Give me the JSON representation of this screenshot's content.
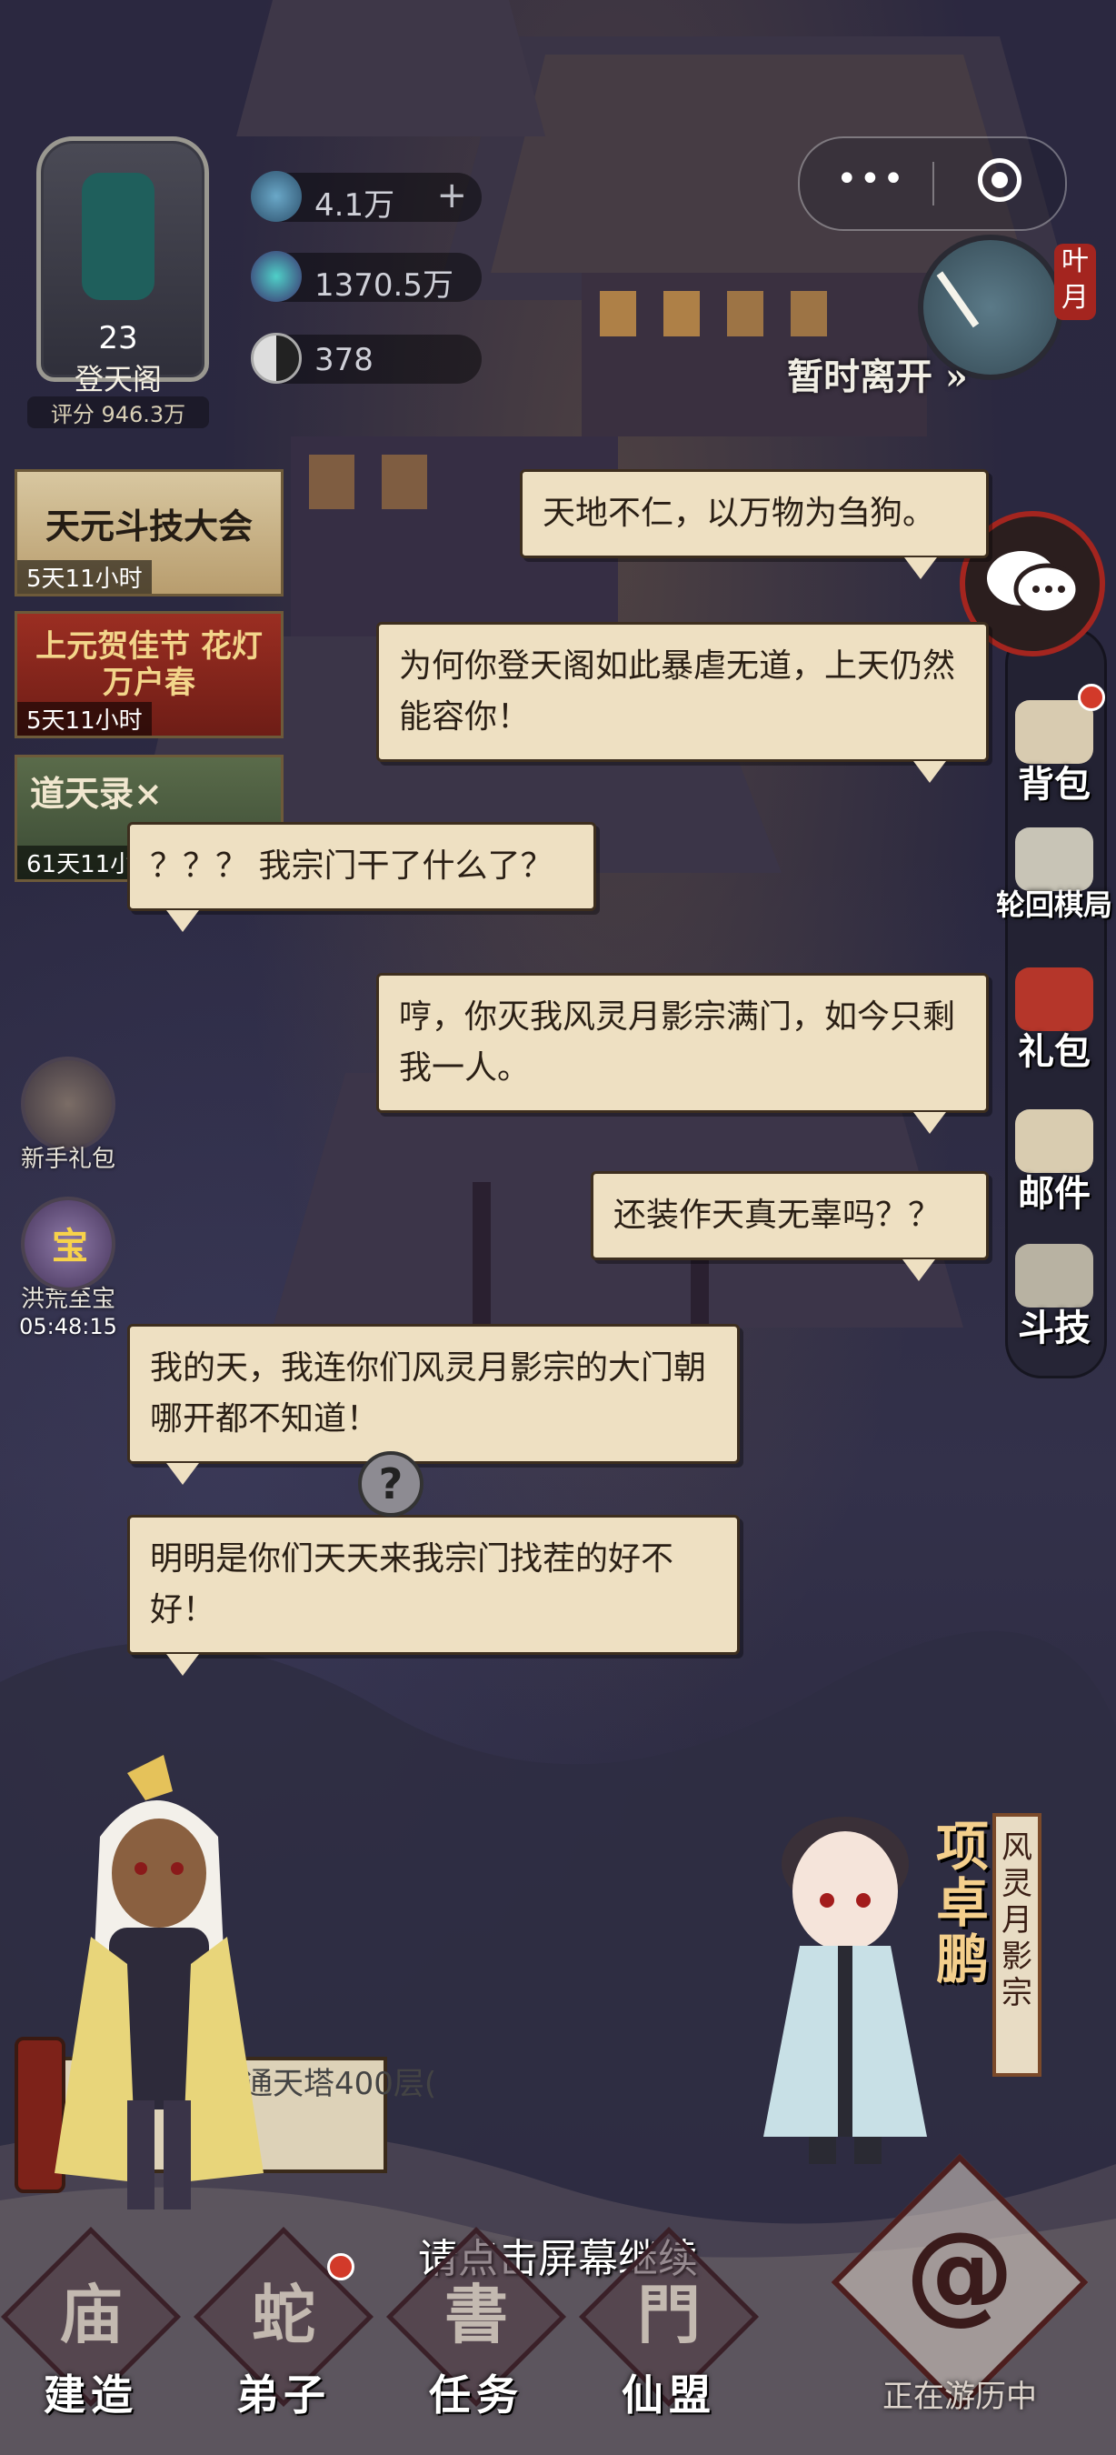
{
  "top": {
    "sect_level": "23",
    "sect_name": "登天阁",
    "sect_score": "评分 946.3万",
    "resources": [
      {
        "icon": "spirit-stone-icon",
        "value": "4.1万",
        "plus": "+"
      },
      {
        "icon": "crystal-icon",
        "value": "1370.5万",
        "plus": ""
      },
      {
        "icon": "yin-yang-icon",
        "value": "378",
        "plus": ""
      }
    ],
    "capsule_menu": "•••",
    "season_tag": "叶月",
    "leave_label": "暂时离开 »"
  },
  "events": [
    {
      "title": "天元斗技大会",
      "timer": "5天11小时"
    },
    {
      "title": "上元贺佳节 花灯万户春",
      "timer": "5天11小时"
    },
    {
      "title": "道天录×",
      "timer": "61天11小"
    }
  ],
  "side_left": [
    {
      "label": "新手礼包",
      "timer": ""
    },
    {
      "label": "洪荒至宝",
      "timer": "05:48:15",
      "badge": "宝"
    }
  ],
  "side_right": [
    {
      "label": "背包"
    },
    {
      "label": "轮回棋局"
    },
    {
      "label": "礼包"
    },
    {
      "label": "邮件"
    },
    {
      "label": "斗技"
    }
  ],
  "dialogue": [
    {
      "speaker": "right",
      "text": "天地不仁，以万物为刍狗。"
    },
    {
      "speaker": "right",
      "text": "为何你登天阁如此暴虐无道，上天仍然能容你！"
    },
    {
      "speaker": "left",
      "text": "？？？ 我宗门干了什么了？"
    },
    {
      "speaker": "right",
      "text": "哼，你灭我风灵月影宗满门，如今只剩我一人。"
    },
    {
      "speaker": "right",
      "text": "还装作天真无辜吗？？"
    },
    {
      "speaker": "left",
      "text": "我的天，我连你们风灵月影宗的大门朝哪开都不知道！"
    },
    {
      "speaker": "left",
      "text": "明明是你们天天来我宗门找茬的好不好！"
    }
  ],
  "npc": {
    "name": "项卓鹏",
    "sect": "风灵月影宗"
  },
  "quest_scroll": "通天塔400层(",
  "quest_scroll_left": "通",
  "qmark": "?",
  "continue_hint": "请点击屏幕继续",
  "bottom_nav": [
    {
      "label": "建造",
      "symbol": "庙"
    },
    {
      "label": "弟子",
      "symbol": "蛇"
    },
    {
      "label": "任务",
      "symbol": "書"
    },
    {
      "label": "仙盟",
      "symbol": "門"
    }
  ],
  "travel": {
    "label": "正在游历中",
    "symbol": "@"
  },
  "colors": {
    "bubble": "#eee0c2",
    "accent_red": "#a4251f",
    "background": "#2b2840"
  }
}
